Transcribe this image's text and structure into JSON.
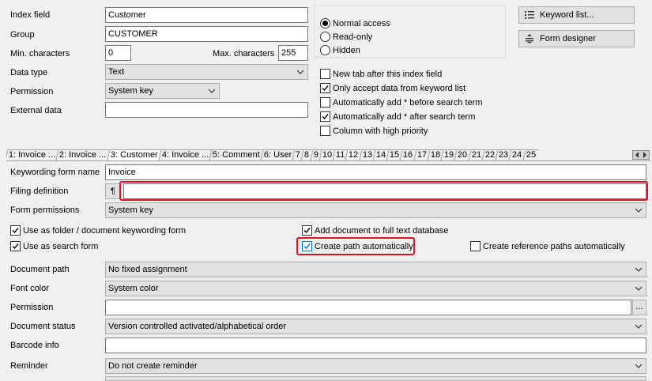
{
  "top": {
    "index_field": {
      "label": "Index field",
      "value": "Customer"
    },
    "group": {
      "label": "Group",
      "value": "CUSTOMER"
    },
    "min_chars": {
      "label": "Min. characters",
      "value": "0"
    },
    "max_chars": {
      "label": "Max. characters",
      "value": "255"
    },
    "data_type": {
      "label": "Data type",
      "value": "Text"
    },
    "permission": {
      "label": "Permission",
      "value": "System key"
    },
    "external_data": {
      "label": "External data",
      "value": ""
    }
  },
  "access": {
    "normal": "Normal access",
    "readonly": "Read-only",
    "hidden": "Hidden",
    "selected": "normal"
  },
  "options": {
    "new_tab": {
      "label": "New tab after this index field",
      "checked": false
    },
    "only_keyword": {
      "label": "Only accept data from keyword list",
      "checked": true
    },
    "add_before": {
      "label": "Automatically add * before search term",
      "checked": false
    },
    "add_after": {
      "label": "Automatically add * after search term",
      "checked": true
    },
    "high_priority": {
      "label": "Column with high priority",
      "checked": false
    }
  },
  "buttons": {
    "keyword_list": "Keyword list...",
    "form_designer": "Form designer"
  },
  "tabs": [
    "1: Invoice ...",
    "2: Invoice ...",
    "3: Customer",
    "4: Invoice ...",
    "5: Comment",
    "6: User",
    "7",
    "8",
    "9",
    "10",
    "11",
    "12",
    "13",
    "14",
    "15",
    "16",
    "17",
    "18",
    "19",
    "20",
    "21",
    "22",
    "23",
    "24",
    "25"
  ],
  "active_tab": 2,
  "form": {
    "keywording_form_name": {
      "label": "Keywording form name",
      "value": "Invoice"
    },
    "filing_definition": {
      "label": "Filing definition",
      "button": "¶",
      "value": ""
    },
    "form_permissions": {
      "label": "Form permissions",
      "value": "System key"
    },
    "use_as_folder": {
      "label": "Use as folder / document keywording form",
      "checked": true
    },
    "use_as_search": {
      "label": "Use as search form",
      "checked": true
    },
    "add_fulltext": {
      "label": "Add document to full text database",
      "checked": true
    },
    "create_path": {
      "label": "Create path automatically",
      "checked": true
    },
    "create_ref_paths": {
      "label": "Create reference paths automatically",
      "checked": false
    },
    "document_path": {
      "label": "Document path",
      "value": "No fixed assignment"
    },
    "font_color": {
      "label": "Font color",
      "value": "System color"
    },
    "permission": {
      "label": "Permission",
      "value": "",
      "button": "..."
    },
    "document_status": {
      "label": "Document status",
      "value": "Version controlled activated/alphabetical order"
    },
    "barcode_info": {
      "label": "Barcode info",
      "value": ""
    },
    "reminder": {
      "label": "Reminder",
      "value": "Do not create reminder"
    }
  },
  "colors": {
    "highlight": "#e81123",
    "accent": "#0078d7"
  }
}
